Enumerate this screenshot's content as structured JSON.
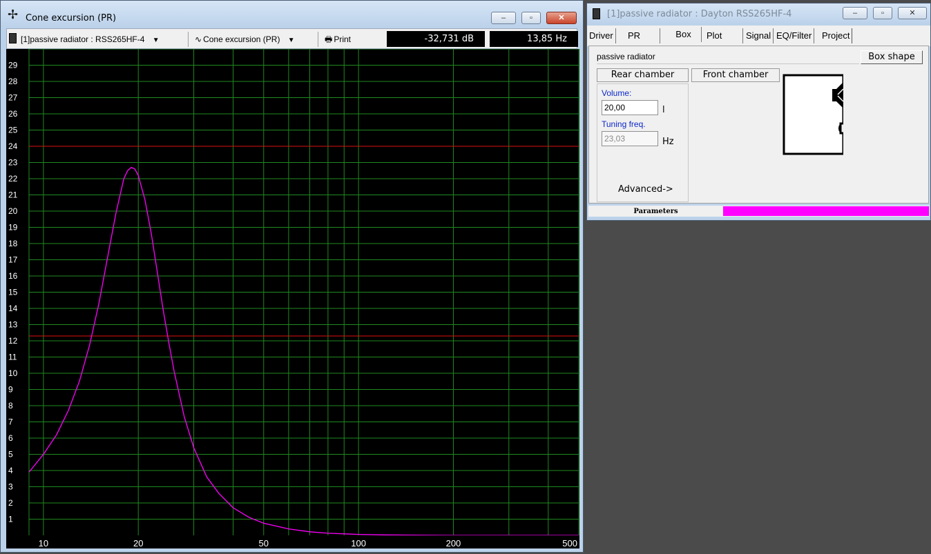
{
  "plot_window": {
    "title": "Cone excursion (PR)",
    "title_icon": "crosshair-icon",
    "controls": {
      "minimize": "‒",
      "maximize": "▫",
      "close": "✕"
    },
    "toolbar": {
      "driver_select": "[1]passive radiator : RSS265HF-4",
      "plot_select": "Cone excursion (PR)",
      "print_label": "Print",
      "readout_db": "-32,731 dB",
      "readout_hz": "13,85 Hz"
    }
  },
  "chart_data": {
    "type": "line",
    "title": "",
    "xlabel": "",
    "ylabel": "",
    "x_scale": "log",
    "xlim": [
      9,
      500
    ],
    "ylim": [
      0,
      30
    ],
    "x_tick_labels": [
      "10",
      "20",
      "50",
      "100",
      "200",
      "500"
    ],
    "y_tick_labels": [
      "1",
      "2",
      "3",
      "4",
      "5",
      "6",
      "7",
      "8",
      "9",
      "10",
      "11",
      "12",
      "13",
      "14",
      "15",
      "16",
      "17",
      "18",
      "19",
      "20",
      "21",
      "22",
      "23",
      "24",
      "25",
      "26",
      "27",
      "28",
      "29"
    ],
    "background": "#000000",
    "grid_color": "#1f8a1f",
    "grid": true,
    "series": [
      {
        "color": "#ff00ff",
        "x": [
          9,
          10,
          11,
          12,
          13,
          14,
          15,
          16,
          17,
          18,
          18.5,
          19,
          19.5,
          20,
          21,
          22,
          23,
          24,
          25,
          26,
          28,
          30,
          33,
          36,
          40,
          45,
          50,
          60,
          70,
          80,
          100,
          120,
          150,
          200,
          300,
          500
        ],
        "y": [
          3.9,
          5.0,
          6.2,
          7.7,
          9.5,
          11.7,
          14.3,
          17.2,
          19.9,
          22.0,
          22.5,
          22.7,
          22.6,
          22.2,
          20.7,
          18.6,
          16.2,
          13.9,
          11.9,
          10.1,
          7.3,
          5.4,
          3.6,
          2.6,
          1.7,
          1.1,
          0.75,
          0.4,
          0.22,
          0.13,
          0.06,
          0.03,
          0.015,
          0.0,
          0.0,
          0.0
        ]
      }
    ],
    "reference_lines": [
      {
        "y": 24.0,
        "color": "#e01010"
      },
      {
        "y": 12.3,
        "color": "#e01010"
      }
    ]
  },
  "box_window": {
    "title": "[1]passive radiator : Dayton RSS265HF-4",
    "controls": {
      "minimize": "‒",
      "maximize": "▫",
      "close": "✕"
    },
    "tabs": [
      "Driver",
      "PR",
      "Box",
      "Plot",
      "Signal",
      "EQ/Filter",
      "Project"
    ],
    "active_tab": "Box",
    "box_name": "passive radiator",
    "box_shape_label": "Box shape",
    "rear_chamber_label": "Rear chamber",
    "front_chamber_label": "Front chamber",
    "volume_label": "Volume:",
    "volume_value": "20,00",
    "volume_unit": "l",
    "tuning_label": "Tuning freq.",
    "tuning_value": "23,03",
    "tuning_unit": "Hz",
    "advanced_label": "Advanced->",
    "status_label": "Parameters",
    "status_color": "#ff00ff"
  }
}
